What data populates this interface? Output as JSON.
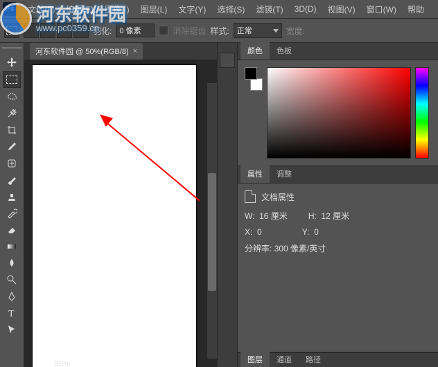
{
  "watermark": {
    "title": "河东软件园",
    "url": "www.pc0359.cn"
  },
  "menubar": {
    "logo": "Ps",
    "items": [
      "文件(F)",
      "编辑(E)",
      "图像(I)",
      "图层(L)",
      "文字(Y)",
      "选择(S)",
      "滤镜(T)",
      "3D(D)",
      "视图(V)",
      "窗口(W)",
      "帮助"
    ]
  },
  "optionsbar": {
    "feather_label": "羽化:",
    "feather_value": "0 像素",
    "antialias": "消除锯齿",
    "style_label": "样式:",
    "style_value": "正常",
    "width_label": "宽度:"
  },
  "document": {
    "tab_title": "河东软件园 @ 50%(RGB/8)",
    "zoom": "50%"
  },
  "color_panel": {
    "tab1": "颜色",
    "tab2": "色板"
  },
  "properties_panel": {
    "tab1": "属性",
    "tab2": "调整",
    "doc_props_label": "文档属性",
    "w_label": "W:",
    "w_value": "16 厘米",
    "h_label": "H:",
    "h_value": "12 厘米",
    "x_label": "X:",
    "x_value": "0",
    "y_label": "Y:",
    "y_value": "0",
    "res_label": "分辨率:",
    "res_value": "300 像素/英寸"
  },
  "layers_panel": {
    "tab1": "图层",
    "tab2": "通道",
    "tab3": "路径"
  },
  "tools": [
    "move",
    "marquee",
    "lasso",
    "magic-wand",
    "crop",
    "eyedropper",
    "healing",
    "brush",
    "clone",
    "history-brush",
    "eraser",
    "gradient",
    "blur",
    "dodge",
    "pen",
    "type",
    "path-select"
  ]
}
